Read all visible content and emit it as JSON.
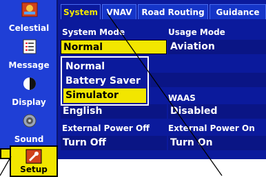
{
  "colors": {
    "screen_bg": "#0b1a9c",
    "sidebar_bg": "#1f3fd6",
    "highlight": "#f2e600",
    "active_tab_text": "#f2e600"
  },
  "sidebar": {
    "items": [
      {
        "label": "Celestial",
        "icon": "celestial-icon"
      },
      {
        "label": "Message",
        "icon": "message-icon"
      },
      {
        "label": "Display",
        "icon": "display-icon"
      },
      {
        "label": "Sound",
        "icon": "sound-icon"
      },
      {
        "label": "Setup",
        "icon": "setup-icon",
        "selected": true
      }
    ]
  },
  "tabs": [
    {
      "label": "System",
      "active": true
    },
    {
      "label": "VNAV"
    },
    {
      "label": "Road Routing"
    },
    {
      "label": "Guidance"
    }
  ],
  "fields": {
    "system_mode": {
      "label": "System Mode",
      "value": "Normal"
    },
    "usage_mode": {
      "label": "Usage Mode",
      "value": "Aviation"
    },
    "language": {
      "value": "English"
    },
    "waas": {
      "label": "WAAS",
      "value": "Disabled"
    },
    "external_power_off": {
      "label": "External Power Off",
      "value": "Turn Off"
    },
    "external_power_on": {
      "label": "External Power On",
      "value": "Turn On"
    }
  },
  "dropdown": {
    "options": [
      "Normal",
      "Battery Saver",
      "Simulator"
    ],
    "selected": "Simulator"
  }
}
